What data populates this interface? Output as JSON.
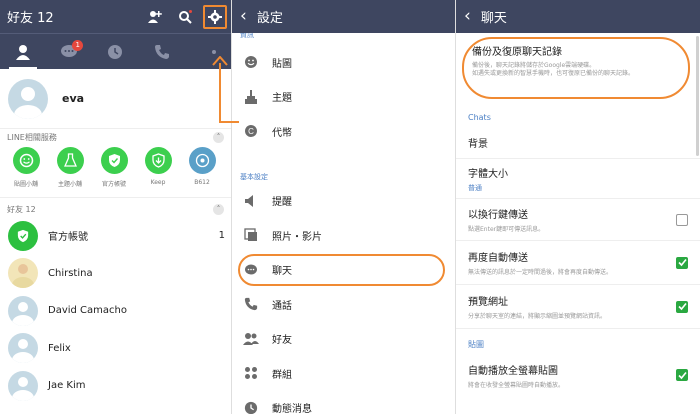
{
  "friends_panel": {
    "title": "好友 12",
    "tab_badge": "1",
    "profile_name": "eva",
    "services_header": "LINE相關服務",
    "services": [
      {
        "label": "貼圖小舖",
        "icon": "smile-icon"
      },
      {
        "label": "主題小舖",
        "icon": "flask-icon"
      },
      {
        "label": "官方帳號",
        "icon": "shield-icon"
      },
      {
        "label": "Keep",
        "icon": "download-shield-icon"
      },
      {
        "label": "B612",
        "icon": "b612-icon"
      }
    ],
    "friends_header": "好友 12",
    "friends": [
      {
        "name": "官方帳號",
        "count": "1"
      },
      {
        "name": "Chirstina",
        "count": ""
      },
      {
        "name": "David Camacho",
        "count": ""
      },
      {
        "name": "Felix",
        "count": ""
      },
      {
        "name": "Jae Kim",
        "count": ""
      }
    ]
  },
  "settings_panel": {
    "title": "設定",
    "cut_label": "資訊",
    "top_items": [
      {
        "label": "貼圖",
        "icon": "smile-icon"
      },
      {
        "label": "主題",
        "icon": "brush-icon"
      },
      {
        "label": "代幣",
        "icon": "coin-icon"
      }
    ],
    "section_basic": "基本設定",
    "basic_items": [
      {
        "label": "提醒",
        "icon": "speaker-icon"
      },
      {
        "label": "照片・影片",
        "icon": "photo-icon"
      },
      {
        "label": "聊天",
        "icon": "chat-bubble-icon"
      },
      {
        "label": "通話",
        "icon": "phone-icon"
      },
      {
        "label": "好友",
        "icon": "friends-icon"
      },
      {
        "label": "群組",
        "icon": "group-icon"
      },
      {
        "label": "動態消息",
        "icon": "clock-icon"
      }
    ]
  },
  "chat_panel": {
    "title": "聊天",
    "backup_title": "備份及復原聊天記錄",
    "backup_desc_1": "備份後，聊天記錄將儲存於Google雲端硬碟。",
    "backup_desc_2": "如遇失或更換新的智慧手機時，也可復原已備份的聊天記錄。",
    "section_chats": "Chats",
    "background_label": "背景",
    "font_size_label": "字體大小",
    "font_size_value": "普通",
    "enter_send_label": "以換行鍵傳送",
    "enter_send_desc": "點選Enter鍵即可傳送訊息。",
    "auto_resend_label": "再度自動傳送",
    "auto_resend_desc": "無法傳送的訊息於一定時間過後，將會再度自動傳送。",
    "url_preview_label": "預覽網址",
    "url_preview_desc": "分享於聊天室的連結，將顯示縮圖並預覽網站資訊。",
    "section_stickers": "貼圖",
    "autoplay_label": "自動播放全螢幕貼圖",
    "autoplay_desc": "將會在收發全螢幕貼圖時自動播放。"
  },
  "colors": {
    "topbar": "#3e4660",
    "annotation": "#f08a32",
    "checkbox_on": "#2aa841",
    "section_blue": "#4b7fc4"
  }
}
